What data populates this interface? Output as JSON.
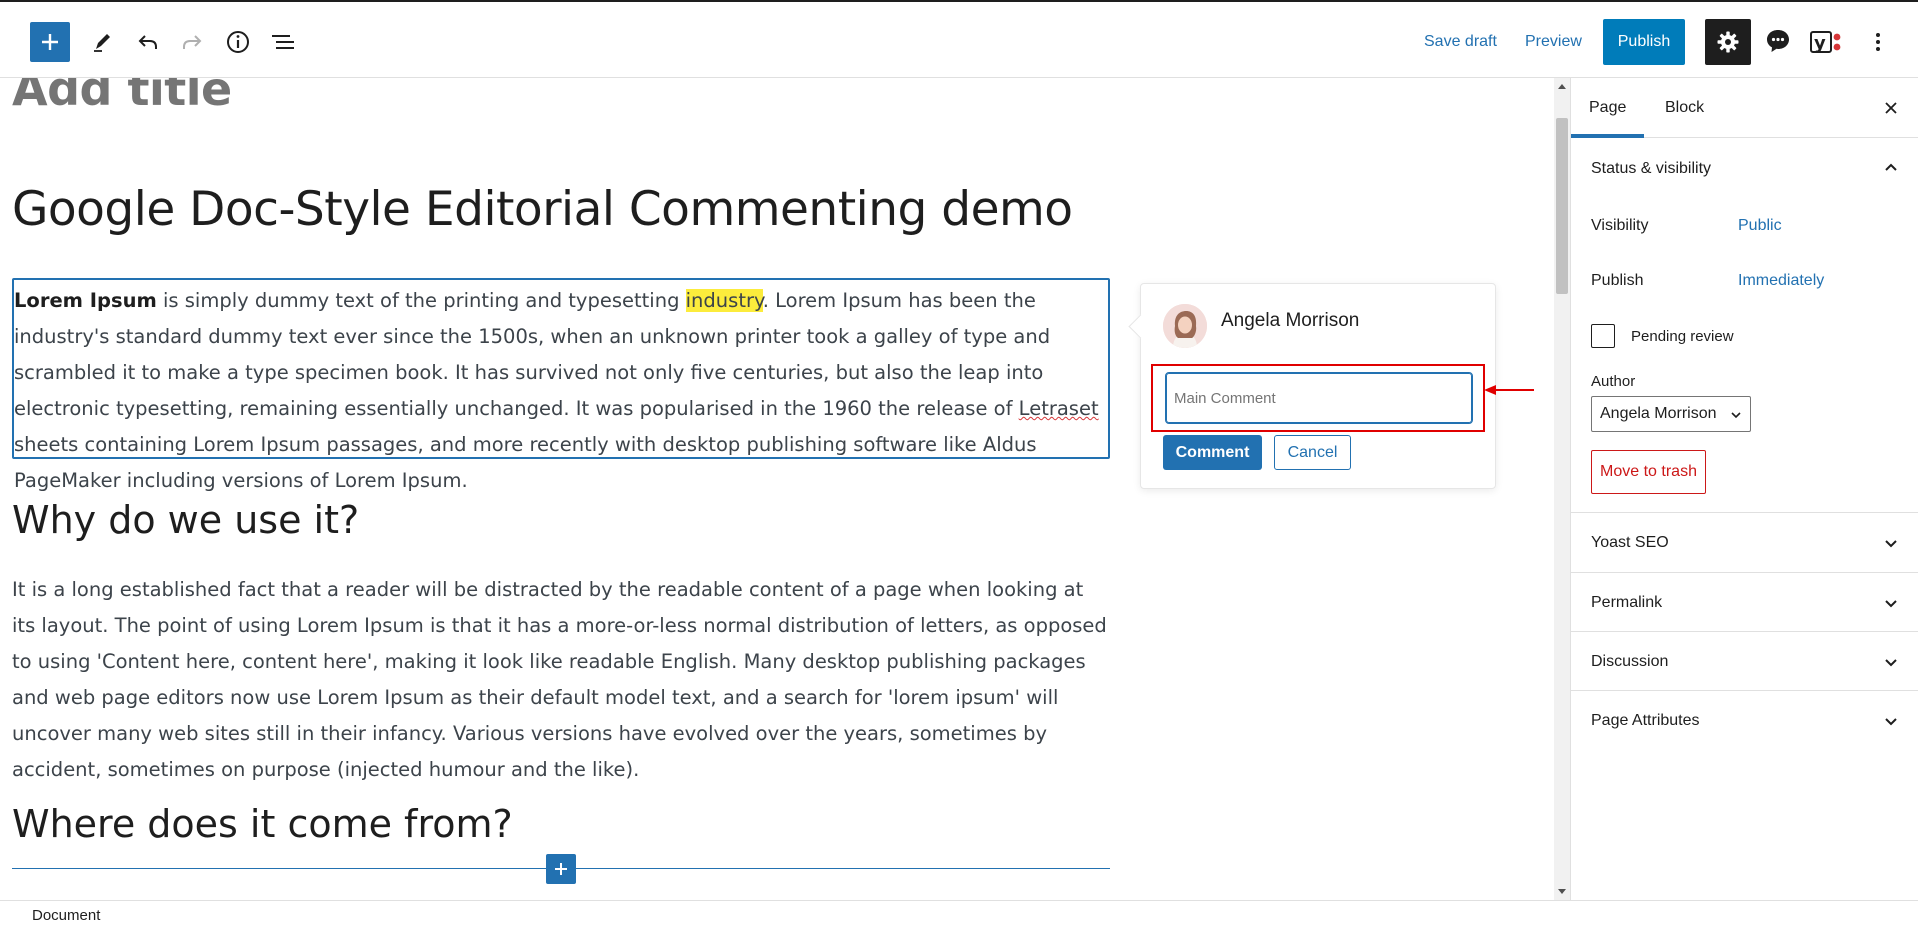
{
  "toolbar": {
    "save_draft": "Save draft",
    "preview": "Preview",
    "publish": "Publish",
    "icons": [
      "plus-icon",
      "pencil-icon",
      "undo-icon",
      "redo-icon",
      "info-icon",
      "list-view-icon",
      "gear-icon",
      "comment-bubble-icon",
      "yoast-icon",
      "more-vertical-icon"
    ]
  },
  "editor": {
    "title_placeholder": "Add title",
    "heading_main": "Google Doc-Style Editorial Commenting demo",
    "para1": {
      "bold": "Lorem Ipsum",
      "before_highlight": " is simply dummy text of the printing and typesetting ",
      "highlight": "industry",
      "after_highlight": ". Lorem Ipsum has been the industry's standard dummy text ever since the 1500s, when an unknown printer took a galley of type and scrambled it to make a type specimen book. It has survived not only five centuries, but also the leap into electronic typesetting, remaining essentially unchanged. It was popularised in the 1960 the release of ",
      "misspelled": "Letraset",
      "end": " sheets containing Lorem Ipsum passages, and more recently with desktop publishing software like Aldus PageMaker including versions of Lorem Ipsum."
    },
    "heading_why": "Why do we use it?",
    "para2": "It is a long established fact that a reader will be distracted by the readable content of a page when looking at its layout. The point of using Lorem Ipsum is that it has a more-or-less normal distribution of letters, as opposed to using 'Content here, content here', making it look like readable English. Many desktop publishing packages and web page editors now use Lorem Ipsum as their default model text, and a search for 'lorem ipsum' will uncover many web sites still in their infancy. Various versions have evolved over the years, sometimes by accident, sometimes on purpose (injected humour and the like).",
    "heading_where": "Where does it come from?"
  },
  "comment": {
    "user_name": "Angela Morrison",
    "input_placeholder": "Main Comment",
    "input_value": "",
    "submit_label": "Comment",
    "cancel_label": "Cancel"
  },
  "sidebar": {
    "tabs": [
      {
        "label": "Page",
        "active": true
      },
      {
        "label": "Block",
        "active": false
      }
    ],
    "status_panel": {
      "title": "Status & visibility",
      "visibility_label": "Visibility",
      "visibility_value": "Public",
      "publish_label": "Publish",
      "publish_value": "Immediately",
      "pending_label": "Pending review",
      "pending_checked": false,
      "author_label": "Author",
      "author_value": "Angela Morrison",
      "trash_label": "Move to trash"
    },
    "panels": [
      {
        "title": "Yoast SEO"
      },
      {
        "title": "Permalink"
      },
      {
        "title": "Discussion"
      },
      {
        "title": "Page Attributes"
      }
    ]
  },
  "footer": {
    "breadcrumb": "Document"
  },
  "colors": {
    "accent": "#2271b1",
    "highlight": "#fcec3c",
    "danger": "#cc1818",
    "annotation_red": "#e00000"
  }
}
